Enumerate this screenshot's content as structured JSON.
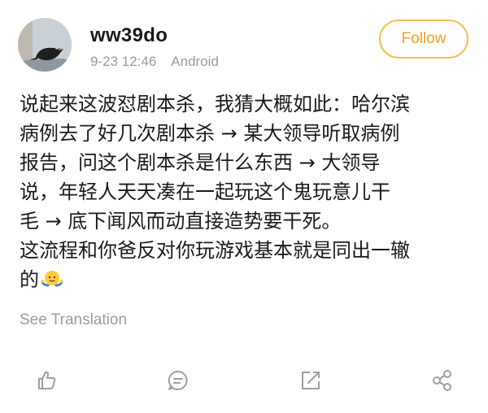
{
  "post": {
    "username": "ww39do",
    "timestamp": "9-23 12:46",
    "source": "Android",
    "follow_label": "Follow",
    "lines": [
      "说起来这波怼剧本杀，我猜大概如此：哈尔滨",
      "病例去了好几次剧本杀 → 某大领导听取病例",
      "报告，问这个剧本杀是什么东西 → 大领导",
      "说，年轻人天天凑在一起玩这个鬼玩意儿干",
      "毛 → 底下闻风而动直接造势要干死。",
      "这流程和你爸反对你玩游戏基本就是同出一辙",
      "的"
    ],
    "emoji": "shrug-emoji",
    "see_translation": "See Translation"
  },
  "actions": [
    {
      "icon": "like-icon"
    },
    {
      "icon": "comment-icon"
    },
    {
      "icon": "repost-icon"
    },
    {
      "icon": "share-icon"
    }
  ],
  "colors": {
    "accent": "#f0a221",
    "follow_border": "#f3be5a",
    "meta_text": "#9a9a9a",
    "icon": "#9e9e9e"
  }
}
